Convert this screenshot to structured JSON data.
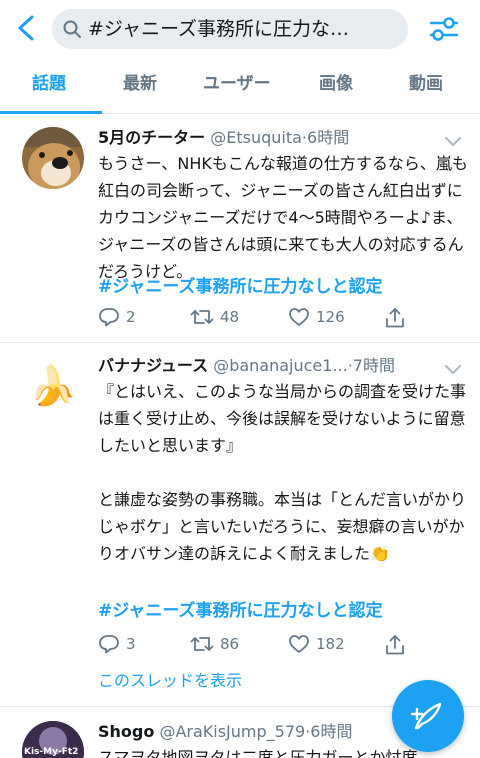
{
  "search": {
    "query": "#ジャニーズ事務所に圧力な…"
  },
  "tabs": [
    "話題",
    "最新",
    "ユーザー",
    "画像",
    "動画"
  ],
  "colors": {
    "accent": "#1da1f2",
    "muted": "#657786",
    "text": "#14171a",
    "divider": "#e1e8ed"
  },
  "tweets": [
    {
      "name": "5月のチーター",
      "handle": "@Etsuquita",
      "time": "6時間",
      "lines": [
        "もうさー、NHKもこんな報道の仕方するなら、嵐も紅白の司会断って、ジャニーズの皆さん紅白出ずにカウコンジャニーズだけで4〜5時間やろーよ♪ま、ジャニーズの皆さんは頭に来ても大人の対応するんだろうけど。"
      ],
      "hashtag": "#ジャニーズ事務所に圧力なしと認定",
      "replies": "2",
      "retweets": "48",
      "likes": "126"
    },
    {
      "name": "バナナジュース",
      "handle": "@bananajuce1...",
      "time": "7時間",
      "avatar_emoji": "🍌",
      "paragraph1": "『とはいえ、このような当局からの調査を受けた事は重く受け止め、今後は誤解を受けないように留意したいと思います』",
      "paragraph2": "と謙虚な姿勢の事務職。本当は「とんだ言いがかりじゃボケ」と言いたいだろうに、妄想癖の言いがかりオバサン達の訴えによく耐えました👏",
      "hashtag": "#ジャニーズ事務所に圧力なしと認定",
      "replies": "3",
      "retweets": "86",
      "likes": "182",
      "show_thread": "このスレッドを表示"
    },
    {
      "name": "Shogo",
      "handle": "@AraKisJump_579",
      "time": "6時間",
      "avatar_text": "Kis-My-Ft2",
      "line1": "スマヲタ地図ヲタは二度と圧力ガーとか忖度"
    }
  ]
}
